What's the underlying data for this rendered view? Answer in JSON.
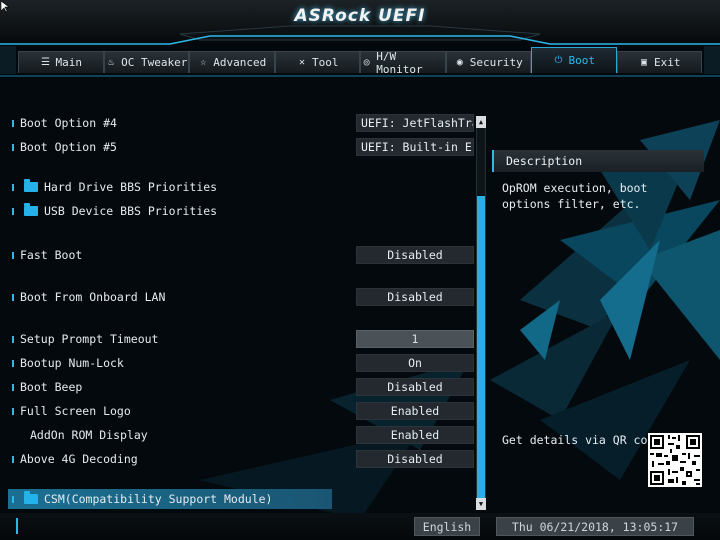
{
  "header": {
    "logo": "ASRock UEFI"
  },
  "tabs": [
    {
      "label": "Main",
      "icon": "list-icon"
    },
    {
      "label": "OC Tweaker",
      "icon": "flame-icon"
    },
    {
      "label": "Advanced",
      "icon": "star-icon"
    },
    {
      "label": "Tool",
      "icon": "tools-icon"
    },
    {
      "label": "H/W Monitor",
      "icon": "monitor-icon"
    },
    {
      "label": "Security",
      "icon": "shield-icon"
    },
    {
      "label": "Boot",
      "icon": "power-icon",
      "active": true
    },
    {
      "label": "Exit",
      "icon": "exit-icon"
    }
  ],
  "settings": {
    "boot_option_4": {
      "label": "Boot Option #4",
      "value": "UEFI: JetFlashTra..."
    },
    "boot_option_5": {
      "label": "Boot Option #5",
      "value": "UEFI: Built-in EF..."
    },
    "hdd_bbs": {
      "label": "Hard Drive BBS Priorities"
    },
    "usb_bbs": {
      "label": "USB Device BBS Priorities"
    },
    "fast_boot": {
      "label": "Fast Boot",
      "value": "Disabled"
    },
    "onboard_lan": {
      "label": "Boot From Onboard LAN",
      "value": "Disabled"
    },
    "setup_timeout": {
      "label": "Setup Prompt Timeout",
      "value": "1"
    },
    "numlock": {
      "label": "Bootup Num-Lock",
      "value": "On"
    },
    "boot_beep": {
      "label": "Boot Beep",
      "value": "Disabled"
    },
    "full_screen_logo": {
      "label": "Full Screen Logo",
      "value": "Enabled"
    },
    "addon_rom": {
      "label": "AddOn ROM Display",
      "value": "Enabled"
    },
    "above_4g": {
      "label": "Above 4G Decoding",
      "value": "Disabled"
    },
    "csm": {
      "label": "CSM(Compatibility Support Module)"
    }
  },
  "description": {
    "title": "Description",
    "text": "OpROM execution, boot options filter, etc.",
    "qr_text": "Get details via QR code"
  },
  "footer": {
    "language": "English",
    "datetime": "Thu 06/21/2018, 13:05:17"
  },
  "colors": {
    "accent": "#2db8ec",
    "background": "#04090d"
  },
  "scroll": {
    "position_fraction": 0.22,
    "visible_fraction": 0.78
  }
}
